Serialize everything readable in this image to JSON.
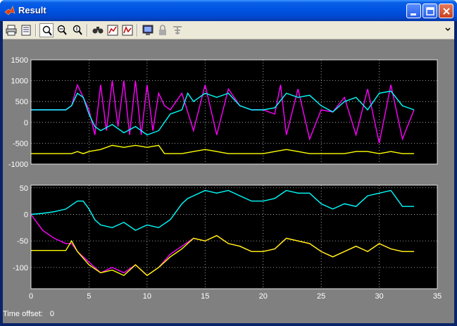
{
  "window": {
    "title": "Result"
  },
  "toolbar": {
    "tools": [
      "print-icon",
      "parameters-icon",
      "zoom-icon",
      "zoom-x-icon",
      "zoom-y-icon",
      "autoscale-icon",
      "save-axes-icon",
      "restore-axes-icon",
      "floating-scope-icon",
      "lock-icon",
      "signal-selection-icon"
    ]
  },
  "status": {
    "label": "Time offset:",
    "value": "0"
  },
  "colors": {
    "magenta": "#ff00ff",
    "cyan": "#00ffff",
    "yellow": "#ffff00",
    "grid": "#c8c8c8",
    "bg": "#000000",
    "panel": "#808080"
  },
  "chart_data": [
    {
      "type": "line",
      "xlim": [
        0,
        35
      ],
      "ylim": [
        -1000,
        1500
      ],
      "yticks": [
        "1500",
        "1000",
        "500",
        "0",
        "-500",
        "-1000"
      ],
      "xticks": [],
      "grid": true,
      "series": [
        {
          "color": "magenta",
          "x": [
            0,
            3,
            3.5,
            4,
            4.5,
            5,
            5.5,
            6,
            6.5,
            7,
            7.5,
            8,
            8.5,
            9,
            9.5,
            10,
            10.5,
            11,
            11.5,
            12,
            13,
            14,
            15,
            16,
            17,
            18,
            19,
            20,
            21,
            21.5,
            22,
            23,
            24,
            25,
            26,
            27,
            28,
            29,
            30,
            31,
            32,
            33
          ],
          "y": [
            300,
            300,
            400,
            900,
            600,
            300,
            -300,
            900,
            -200,
            1000,
            -100,
            1000,
            -300,
            1000,
            -300,
            900,
            -200,
            700,
            400,
            300,
            700,
            -200,
            900,
            -300,
            800,
            400,
            300,
            300,
            200,
            900,
            -300,
            800,
            -400,
            300,
            250,
            600,
            -300,
            800,
            -500,
            900,
            -400,
            300
          ]
        },
        {
          "color": "cyan",
          "x": [
            0,
            3,
            3.5,
            4,
            4.5,
            5,
            5.5,
            6,
            7,
            8,
            9,
            10,
            11,
            12,
            13,
            13.5,
            14,
            15,
            16,
            17,
            18,
            19,
            20,
            21,
            22,
            23,
            24,
            25,
            26,
            27,
            28,
            29,
            30,
            31,
            32,
            33
          ],
          "y": [
            300,
            300,
            400,
            700,
            600,
            200,
            -100,
            -200,
            -50,
            -250,
            -100,
            -300,
            -200,
            200,
            300,
            700,
            500,
            700,
            600,
            700,
            400,
            300,
            300,
            350,
            700,
            600,
            650,
            400,
            250,
            500,
            600,
            300,
            700,
            750,
            400,
            300
          ]
        },
        {
          "color": "yellow",
          "x": [
            0,
            3.5,
            4,
            4.5,
            5,
            6,
            7,
            8,
            9,
            10,
            11,
            11.5,
            12,
            13,
            14,
            15,
            16,
            17,
            18,
            19,
            20,
            21,
            22,
            23,
            24,
            25,
            26,
            27,
            28,
            29,
            30,
            31,
            32,
            33
          ],
          "y": [
            -750,
            -750,
            -700,
            -750,
            -700,
            -650,
            -550,
            -600,
            -550,
            -600,
            -550,
            -750,
            -750,
            -750,
            -700,
            -650,
            -700,
            -750,
            -750,
            -750,
            -750,
            -700,
            -650,
            -700,
            -750,
            -750,
            -750,
            -750,
            -700,
            -700,
            -750,
            -700,
            -750,
            -750
          ]
        }
      ]
    },
    {
      "type": "line",
      "xlim": [
        0,
        35
      ],
      "ylim": [
        -140,
        55
      ],
      "yticks": [
        "50",
        "0",
        "-50",
        "-100"
      ],
      "xticks": [
        "0",
        "5",
        "10",
        "15",
        "20",
        "25",
        "30",
        "35"
      ],
      "grid": true,
      "series": [
        {
          "color": "cyan",
          "x": [
            0,
            1,
            2,
            3,
            4,
            4.5,
            5,
            5.5,
            6,
            7,
            8,
            9,
            10,
            11,
            12,
            13,
            13.5,
            14,
            15,
            16,
            17,
            18,
            19,
            20,
            21,
            22,
            23,
            24,
            25,
            26,
            27,
            28,
            29,
            30,
            31,
            32,
            33
          ],
          "y": [
            0,
            2,
            5,
            10,
            25,
            25,
            10,
            -10,
            -20,
            -25,
            -15,
            -30,
            -20,
            -25,
            -10,
            20,
            30,
            35,
            45,
            40,
            45,
            35,
            25,
            25,
            30,
            45,
            40,
            40,
            20,
            10,
            20,
            15,
            35,
            40,
            45,
            15,
            15
          ]
        },
        {
          "color": "magenta",
          "x": [
            0,
            1,
            2,
            3,
            3.5,
            4,
            5,
            6,
            7,
            8,
            9,
            10,
            11,
            12,
            13,
            14,
            15,
            16,
            17,
            18,
            19,
            20,
            21,
            22,
            23,
            24,
            25,
            26,
            27,
            28,
            29,
            30,
            31,
            32,
            33
          ],
          "y": [
            0,
            -30,
            -45,
            -55,
            -55,
            -70,
            -90,
            -110,
            -100,
            -110,
            -95,
            -115,
            -100,
            -75,
            -60,
            -45,
            -50,
            -40,
            -55,
            -60,
            -70,
            -70,
            -65,
            -45,
            -50,
            -55,
            -70,
            -80,
            -70,
            -60,
            -70,
            -55,
            -65,
            -70,
            -70
          ]
        },
        {
          "color": "yellow",
          "x": [
            0,
            3,
            3.5,
            4,
            5,
            6,
            7,
            8,
            9,
            10,
            11,
            12,
            13,
            14,
            15,
            16,
            17,
            18,
            19,
            20,
            21,
            22,
            23,
            24,
            25,
            26,
            27,
            28,
            29,
            30,
            31,
            32,
            33
          ],
          "y": [
            -68,
            -68,
            -50,
            -70,
            -95,
            -110,
            -105,
            -115,
            -95,
            -115,
            -100,
            -80,
            -65,
            -45,
            -50,
            -40,
            -55,
            -60,
            -70,
            -70,
            -65,
            -45,
            -50,
            -55,
            -70,
            -80,
            -70,
            -60,
            -70,
            -55,
            -65,
            -70,
            -70
          ]
        }
      ]
    }
  ]
}
